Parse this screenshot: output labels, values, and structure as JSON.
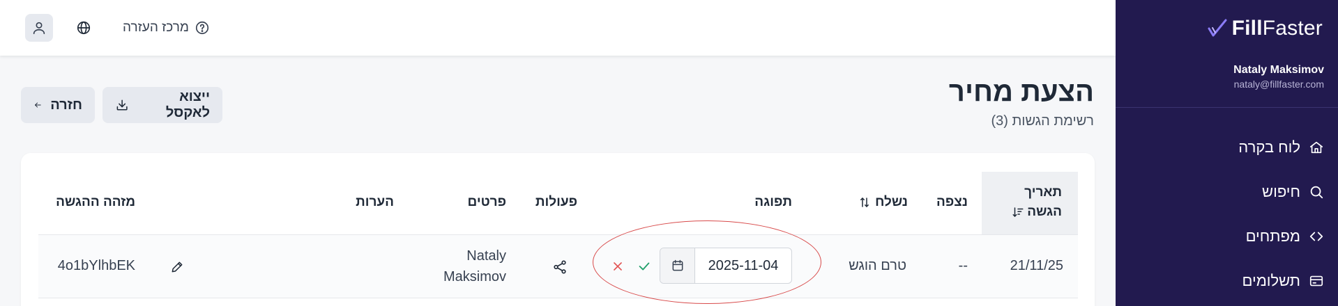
{
  "sidebar": {
    "brand_fill": "Fill",
    "brand_faster": "Faster",
    "user_name": "Nataly Maksimov",
    "user_email": "nataly@fillfaster.com",
    "items": [
      {
        "label": "לוח בקרה",
        "icon": "home-icon"
      },
      {
        "label": "חיפוש",
        "icon": "search-icon"
      },
      {
        "label": "מפתחים",
        "icon": "code-icon"
      },
      {
        "label": "תשלומים",
        "icon": "credit-card-icon"
      }
    ]
  },
  "topbar": {
    "help_label": "מרכז העזרה"
  },
  "header": {
    "title": "הצעת מחיר",
    "subtitle": "רשימת הגשות (3)",
    "export_label": "ייצוא לאקסל",
    "back_label": "חזרה"
  },
  "table": {
    "headers": {
      "date_line1": "תאריך",
      "date_line2": "הגשה",
      "viewed": "נצפה",
      "sent": "נשלח",
      "response": "תפוגה",
      "actions": "פעולות",
      "details": "פרטים",
      "notes": "הערות",
      "submission_id": "מזהה ההגשה"
    },
    "row": {
      "date": "21/11/25",
      "viewed": "--",
      "sent": "טרם הוגש",
      "expiry": "2025-11-04",
      "details_line1": "Nataly",
      "details_line2": "Maksimov",
      "submission_id": "4o1bYlhbEK"
    }
  },
  "colors": {
    "sidebar_bg": "#221a4f",
    "annotation": "#d84a4a",
    "cancel": "#e25353",
    "confirm": "#22a06b"
  }
}
